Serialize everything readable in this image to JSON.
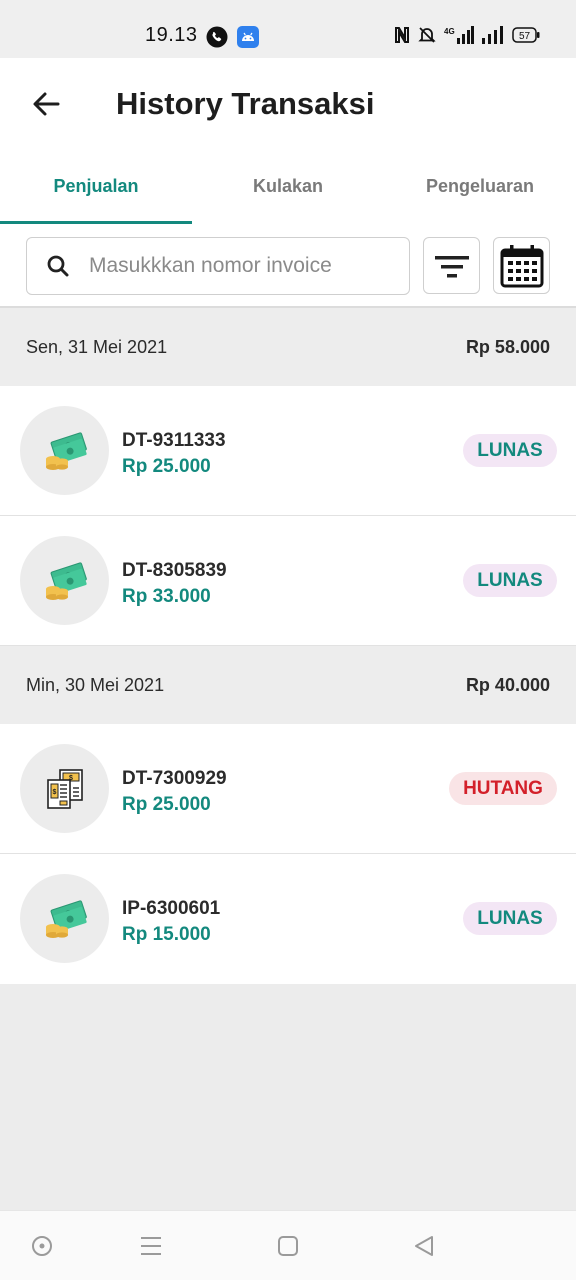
{
  "status": {
    "time": "19.13",
    "battery": "57",
    "network": "4G"
  },
  "header": {
    "title": "History Transaksi"
  },
  "tabs": [
    {
      "label": "Penjualan",
      "active": true
    },
    {
      "label": "Kulakan",
      "active": false
    },
    {
      "label": "Pengeluaran",
      "active": false
    }
  ],
  "search": {
    "placeholder": "Masukkkan nomor invoice",
    "value": ""
  },
  "groups": [
    {
      "date": "Sen, 31 Mei 2021",
      "total": "Rp 58.000",
      "transactions": [
        {
          "id": "DT-9311333",
          "amount": "Rp 25.000",
          "status": "LUNAS",
          "icon": "cash-icon"
        },
        {
          "id": "DT-8305839",
          "amount": "Rp 33.000",
          "status": "LUNAS",
          "icon": "cash-icon"
        }
      ]
    },
    {
      "date": "Min, 30 Mei 2021",
      "total": "Rp 40.000",
      "transactions": [
        {
          "id": "DT-7300929",
          "amount": "Rp 25.000",
          "status": "HUTANG",
          "icon": "receipt-icon"
        },
        {
          "id": "IP-6300601",
          "amount": "Rp 15.000",
          "status": "LUNAS",
          "icon": "cash-icon"
        }
      ]
    }
  ],
  "colors": {
    "accent": "#13897e",
    "debt": "#d3202a",
    "paid_bg": "#f3e6f5",
    "debt_bg": "#f9e4e6"
  }
}
